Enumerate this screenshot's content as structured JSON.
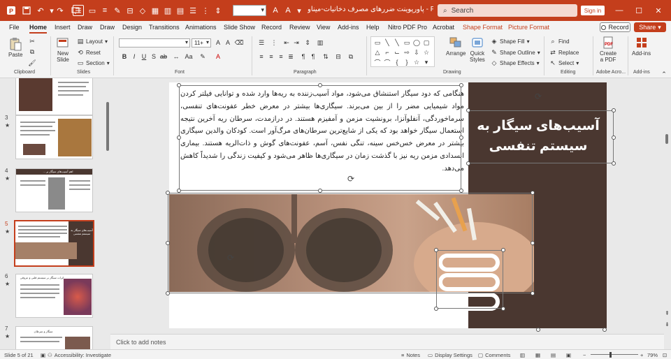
{
  "titlebar": {
    "title": "پاورپوینت ضررهای مصرف دخانیات-میناو  -  Powe...",
    "search_placeholder": "Search",
    "signin": "Sign in",
    "accent": "#c43e1c"
  },
  "menu": {
    "tabs": [
      "File",
      "Home",
      "Insert",
      "Draw",
      "Draw",
      "Design",
      "Transitions",
      "Animations",
      "Slide Show",
      "Record",
      "Review",
      "View",
      "Add-ins",
      "Help",
      "Nitro PDF Pro",
      "Acrobat"
    ],
    "context_tabs": [
      "Shape Format",
      "Picture Format"
    ],
    "active": "Home",
    "record": "Record",
    "share": "Share"
  },
  "ribbon": {
    "clipboard": {
      "label": "Clipboard",
      "paste": "Paste"
    },
    "slides": {
      "label": "Slides",
      "new_slide": "New",
      "new_slide2": "Slide",
      "layout": "Layout",
      "reset": "Reset",
      "section": "Section"
    },
    "font": {
      "label": "Font",
      "size": "11+"
    },
    "paragraph": {
      "label": "Paragraph"
    },
    "drawing": {
      "label": "Drawing",
      "arrange": "Arrange",
      "quick_styles": "Quick",
      "quick_styles2": "Styles",
      "shape_fill": "Shape Fill",
      "shape_outline": "Shape Outline",
      "shape_effects": "Shape Effects"
    },
    "editing": {
      "label": "Editing",
      "find": "Find",
      "replace": "Replace",
      "select": "Select"
    },
    "adobe": {
      "label": "Adobe Acro...",
      "create_pdf": "Create",
      "create_pdf2": "a PDF"
    },
    "addins": {
      "label": "Add-ins",
      "addins_btn": "Add-ins"
    }
  },
  "thumbnails": {
    "items": [
      {
        "num": "3",
        "star": "★"
      },
      {
        "num": "4",
        "star": "★"
      },
      {
        "num": "5",
        "star": "★"
      },
      {
        "num": "6",
        "star": "★"
      },
      {
        "num": "7",
        "star": "★"
      }
    ],
    "t4_title": "اهم آسیب‌های سیگار بر ...",
    "t5_title": "آسیب‌های سیگار به سیستم تنفسی",
    "t6_title": "اثرات سیگار بر سیستم قلبی و عروقی",
    "t7_title": "سیگار و سرطان"
  },
  "slide": {
    "title": "آسیب‌های سیگار به سیستم تنفسی",
    "body": "هنگامی که دود سیگار استنشاق می‌شود، مواد آسیب‌زننده به ریه‌ها وارد شده و توانایی فیلتر کردن مواد شیمیایی مضر را از بین می‌برند. سیگاری‌ها بیشتر در معرض خطر عفونت‌های تنفسی، سرماخوردگی، آنفلوآنزا، برونشیت مزمن و آمفیزم هستند. در درازمدت، سرطان ریه آخرین نتیجه استعمال سیگار خواهد بود که یکی از شایع‌ترین سرطان‌های مرگ‌آور است. کودکان والدین سیگاری بیشتر در معرض خس‌خس سینه، تنگی نفس، آسم، عفونت‌های گوش و ذات‌الریه هستند. بیماری انسدادی مزمن ریه نیز با گذشت زمان در سیگاری‌ها ظاهر می‌شود و کیفیت زندگی را شدیداً کاهش می‌دهد.",
    "panel_color": "#4a3730"
  },
  "notes": {
    "placeholder": "Click to add notes"
  },
  "status": {
    "slide_of": "Slide 5 of 21",
    "accessibility": "Accessibility: Investigate",
    "notes": "Notes",
    "display": "Display Settings",
    "comments": "Comments",
    "zoom": "79%"
  }
}
